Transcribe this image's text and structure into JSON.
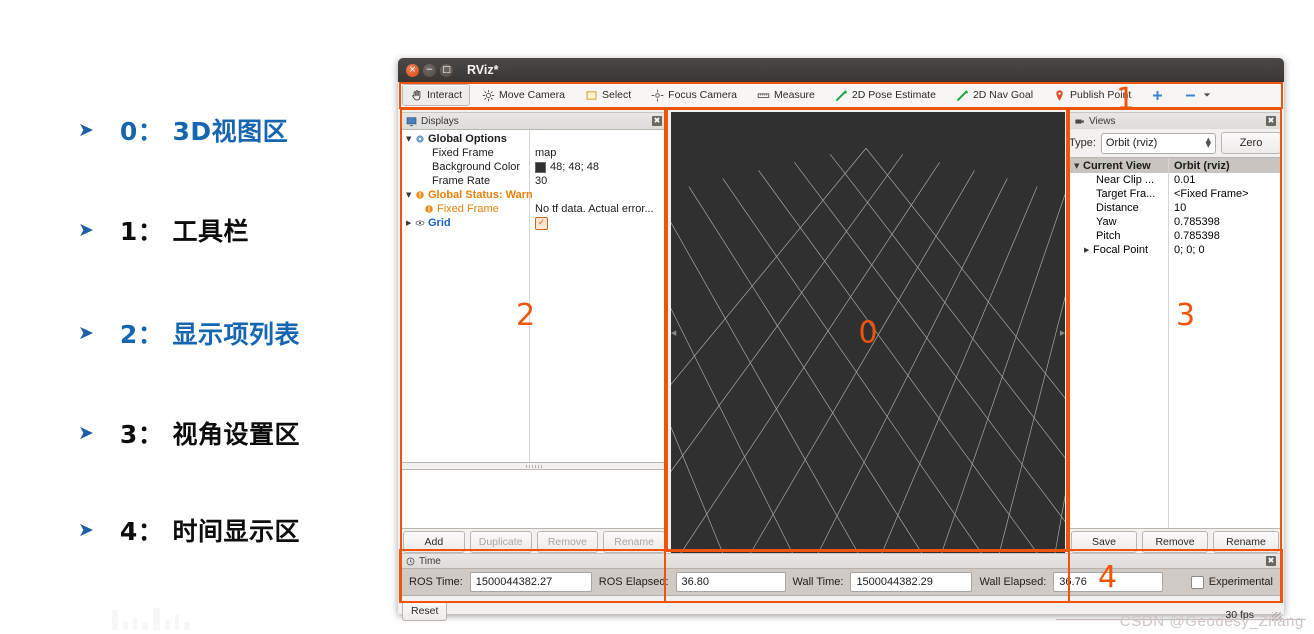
{
  "annotations": {
    "bullet_glyph": "➤",
    "accent_blue": "#1665b0",
    "items": [
      {
        "label": "0： 3D视图区",
        "color": "blue"
      },
      {
        "label": "1： 工具栏",
        "color": "black"
      },
      {
        "label": "2： 显示项列表",
        "color": "blue"
      },
      {
        "label": "3： 视角设置区",
        "color": "black"
      },
      {
        "label": "4： 时间显示区",
        "color": "black"
      }
    ]
  },
  "window": {
    "title": "RViz*",
    "buttons": {
      "close": "×",
      "minimize": "−",
      "maximize": "□"
    }
  },
  "toolbar": {
    "items": [
      {
        "label": "Interact",
        "icon": "hand-icon",
        "active": true
      },
      {
        "label": "Move Camera",
        "icon": "move-camera-icon",
        "active": false
      },
      {
        "label": "Select",
        "icon": "select-rect-icon",
        "active": false
      },
      {
        "label": "Focus Camera",
        "icon": "focus-camera-icon",
        "active": false
      },
      {
        "label": "Measure",
        "icon": "measure-icon",
        "active": false
      },
      {
        "label": "2D Pose Estimate",
        "icon": "pose-arrow-icon",
        "active": false
      },
      {
        "label": "2D Nav Goal",
        "icon": "nav-goal-arrow-icon",
        "active": false
      },
      {
        "label": "Publish Point",
        "icon": "map-pin-icon",
        "active": false
      }
    ],
    "plus_icon": "plus-icon",
    "minus_icon": "minus-icon",
    "overflow_icon": "chevron-down-icon"
  },
  "displays": {
    "panel_title": "Displays",
    "close_glyph": "✖",
    "rows": [
      {
        "arrow": "▼",
        "icon": "gear-icon",
        "name": "Global Options",
        "value": "",
        "style": "bold-dark",
        "indent": 0
      },
      {
        "arrow": "",
        "icon": "",
        "name": "Fixed Frame",
        "value": "map",
        "style": "normal",
        "indent": 1
      },
      {
        "arrow": "",
        "icon": "",
        "name": "Background Color",
        "value": "48; 48; 48",
        "style": "swatch",
        "indent": 1
      },
      {
        "arrow": "",
        "icon": "",
        "name": "Frame Rate",
        "value": "30",
        "style": "normal",
        "indent": 1
      },
      {
        "arrow": "▼",
        "icon": "warning-icon",
        "name": "Global Status: Warn",
        "value": "",
        "style": "warn",
        "indent": 0
      },
      {
        "arrow": "",
        "icon": "warning-icon",
        "name": "Fixed Frame",
        "value": "No tf data.  Actual error...",
        "style": "warn-child",
        "indent": 1
      },
      {
        "arrow": "▶",
        "icon": "grid-icon",
        "name": "Grid",
        "value": "",
        "style": "link-check",
        "indent": 0
      }
    ],
    "buttons": [
      {
        "label": "Add",
        "enabled": true
      },
      {
        "label": "Duplicate",
        "enabled": false
      },
      {
        "label": "Remove",
        "enabled": false
      },
      {
        "label": "Rename",
        "enabled": false
      }
    ]
  },
  "viewport": {
    "background_color": "#303030",
    "grid_color": "#b4b4b4",
    "callout_number": "0"
  },
  "views": {
    "panel_title": "Views",
    "close_glyph": "✖",
    "type_label": "Type:",
    "type_value": "Orbit (rviz)",
    "zero_button": "Zero",
    "header": {
      "name": "Current View",
      "value": "Orbit (rviz)",
      "arrow": "▼"
    },
    "rows": [
      {
        "arrow": "",
        "name": "Near Clip ...",
        "value": "0.01"
      },
      {
        "arrow": "",
        "name": "Target Fra...",
        "value": "<Fixed Frame>"
      },
      {
        "arrow": "",
        "name": "Distance",
        "value": "10"
      },
      {
        "arrow": "",
        "name": "Yaw",
        "value": "0.785398"
      },
      {
        "arrow": "",
        "name": "Pitch",
        "value": "0.785398"
      },
      {
        "arrow": "▶",
        "name": "Focal Point",
        "value": "0; 0; 0"
      }
    ],
    "buttons": [
      {
        "label": "Save"
      },
      {
        "label": "Remove"
      },
      {
        "label": "Rename"
      }
    ]
  },
  "time": {
    "panel_title": "Time",
    "close_glyph": "✖",
    "fields": [
      {
        "label": "ROS Time:",
        "value": "1500044382.27",
        "width": 110
      },
      {
        "label": "ROS Elapsed:",
        "value": "36.80",
        "width": 98
      },
      {
        "label": "Wall Time:",
        "value": "1500044382.29",
        "width": 110
      },
      {
        "label": "Wall Elapsed:",
        "value": "36.76",
        "width": 98
      }
    ],
    "experimental_label": "Experimental",
    "callout_number": "4"
  },
  "statusbar": {
    "reset_label": "Reset",
    "fps": "30 fps"
  },
  "callouts": {
    "toolbar": "1",
    "displays": "2",
    "views": "3"
  },
  "watermark": {
    "text": "CSDN @Geodesy_Zhang"
  }
}
